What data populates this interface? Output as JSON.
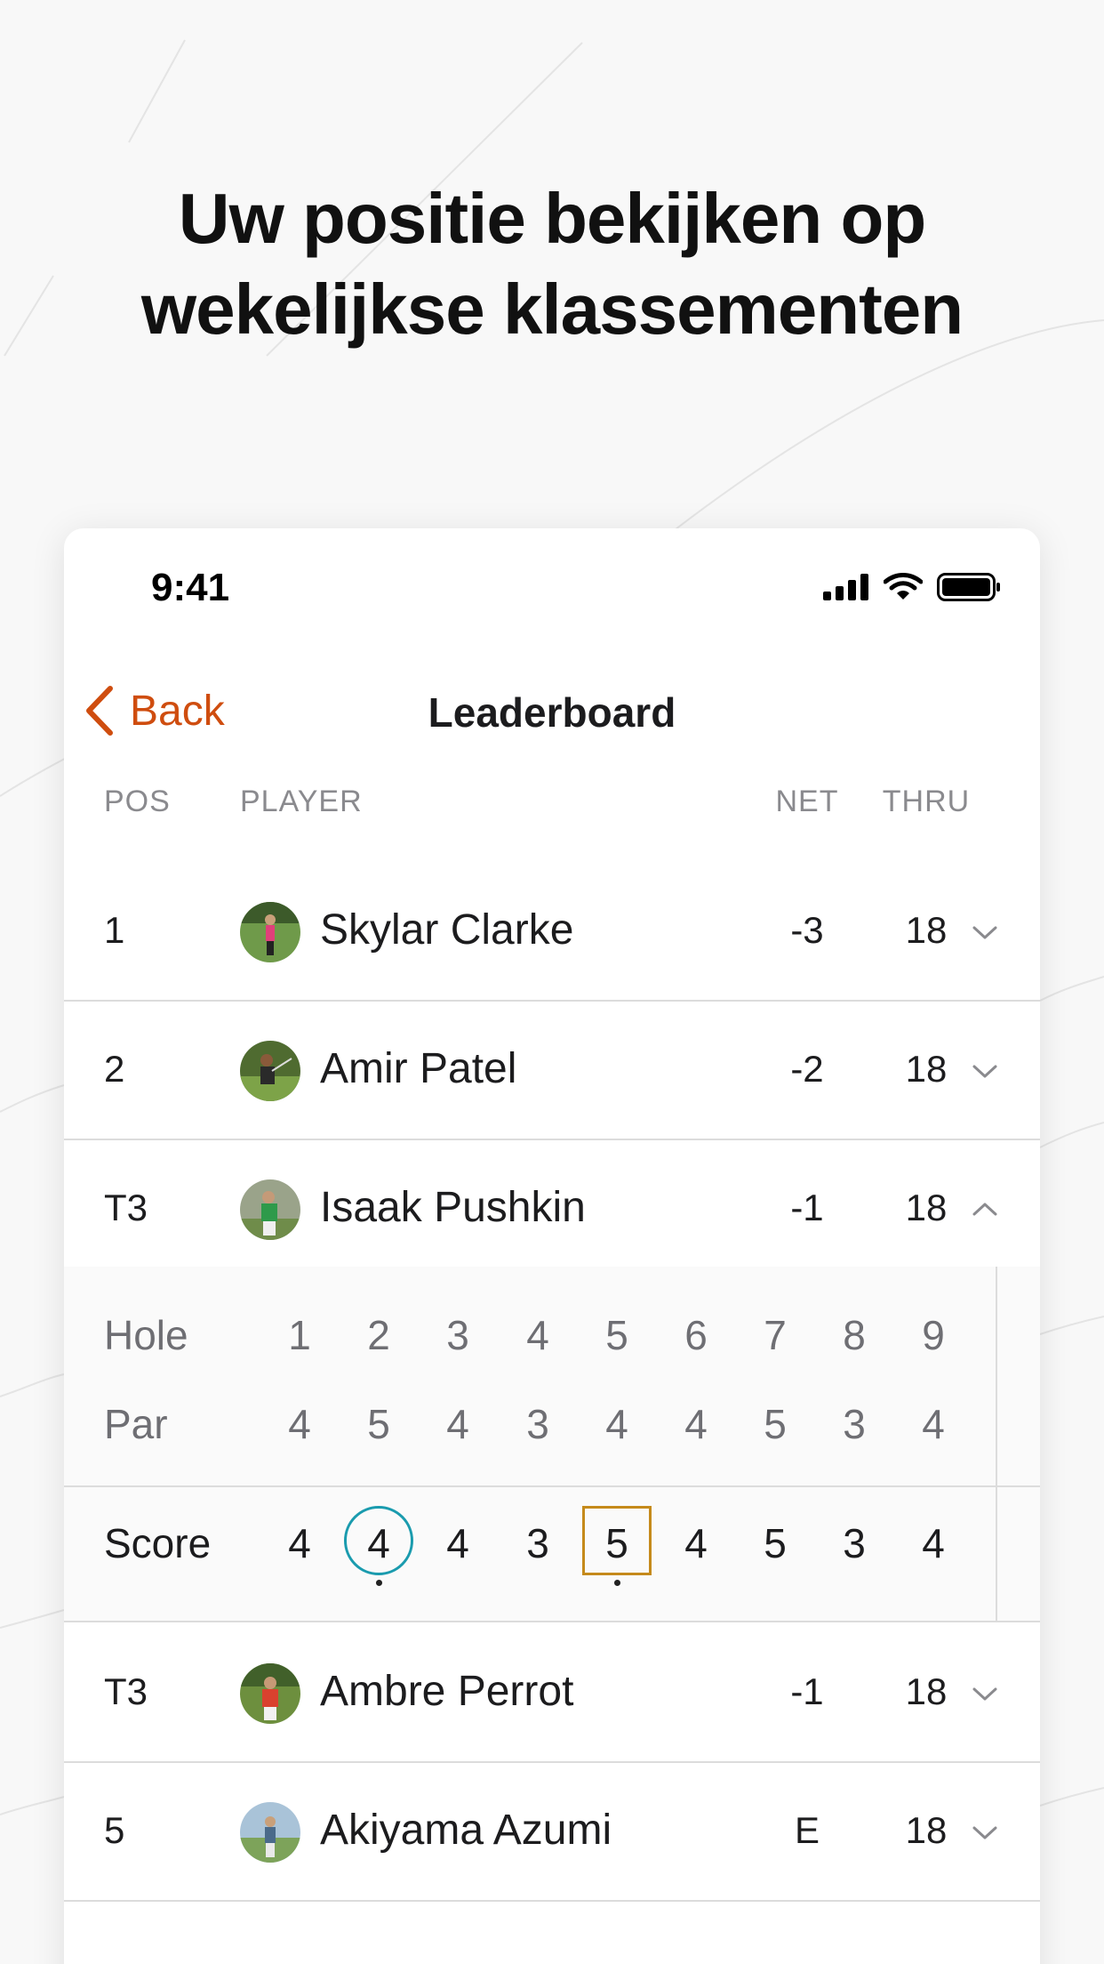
{
  "headline": {
    "line1": "Uw positie bekijken op",
    "line2": "wekelijkse klassementen"
  },
  "status_bar": {
    "time": "9:41",
    "icons": [
      "signal-icon",
      "wifi-icon",
      "battery-icon"
    ]
  },
  "nav": {
    "back_label": "Back",
    "title": "Leaderboard"
  },
  "columns": {
    "pos": "POS",
    "player": "PLAYER",
    "net": "NET",
    "thru": "THRU"
  },
  "players": [
    {
      "pos": "1",
      "name": "Skylar Clarke",
      "net": "-3",
      "thru": "18",
      "expanded": false
    },
    {
      "pos": "2",
      "name": "Amir Patel",
      "net": "-2",
      "thru": "18",
      "expanded": false
    },
    {
      "pos": "T3",
      "name": "Isaak Pushkin",
      "net": "-1",
      "thru": "18",
      "expanded": true
    },
    {
      "pos": "T3",
      "name": "Ambre Perrot",
      "net": "-1",
      "thru": "18",
      "expanded": false
    },
    {
      "pos": "5",
      "name": "Akiyama Azumi",
      "net": "E",
      "thru": "18",
      "expanded": false
    }
  ],
  "scorecard": {
    "hole_label": "Hole",
    "par_label": "Par",
    "score_label": "Score",
    "holes": [
      "1",
      "2",
      "3",
      "4",
      "5",
      "6",
      "7",
      "8",
      "9"
    ],
    "par": [
      "4",
      "5",
      "4",
      "3",
      "4",
      "4",
      "5",
      "3",
      "4"
    ],
    "score": [
      "4",
      "4",
      "4",
      "3",
      "5",
      "4",
      "5",
      "3",
      "4"
    ],
    "birdie_hole_index": 1,
    "bogey_hole_index": 4
  },
  "colors": {
    "accent": "#cf4d0f",
    "birdie": "#1a9bae",
    "bogey": "#c58a1b"
  }
}
